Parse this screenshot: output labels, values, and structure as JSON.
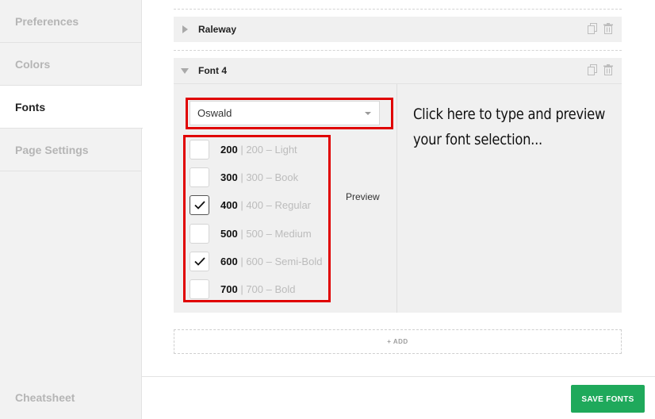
{
  "sidebar": {
    "items": [
      {
        "label": "Preferences",
        "active": false
      },
      {
        "label": "Colors",
        "active": false
      },
      {
        "label": "Fonts",
        "active": true
      },
      {
        "label": "Page Settings",
        "active": false
      }
    ],
    "cheatsheet_label": "Cheatsheet"
  },
  "fonts": {
    "panel_raleway": {
      "title": "Raleway",
      "collapsed": true
    },
    "panel_font4": {
      "title": "Font 4",
      "collapsed": false,
      "family_select": {
        "value": "Oswald"
      },
      "weights": [
        {
          "weight": "200",
          "name": "200 – Light",
          "checked": false
        },
        {
          "weight": "300",
          "name": "300 – Book",
          "checked": false
        },
        {
          "weight": "400",
          "name": "400 – Regular",
          "checked": true
        },
        {
          "weight": "500",
          "name": "500 – Medium",
          "checked": false
        },
        {
          "weight": "600",
          "name": "600 – Semi-Bold",
          "checked": true
        },
        {
          "weight": "700",
          "name": "700 – Bold",
          "checked": false
        }
      ],
      "preview_label": "Preview",
      "preview_text": "Click here to type and preview your font selection..."
    },
    "add_label": "+ ADD"
  },
  "footer": {
    "save_label": "SAVE FONTS"
  },
  "colors": {
    "save_button": "#1fa95b",
    "highlight": "#e00000"
  },
  "icons": {
    "duplicate": "copy-icon",
    "delete": "trash-icon",
    "check": "check-icon"
  }
}
